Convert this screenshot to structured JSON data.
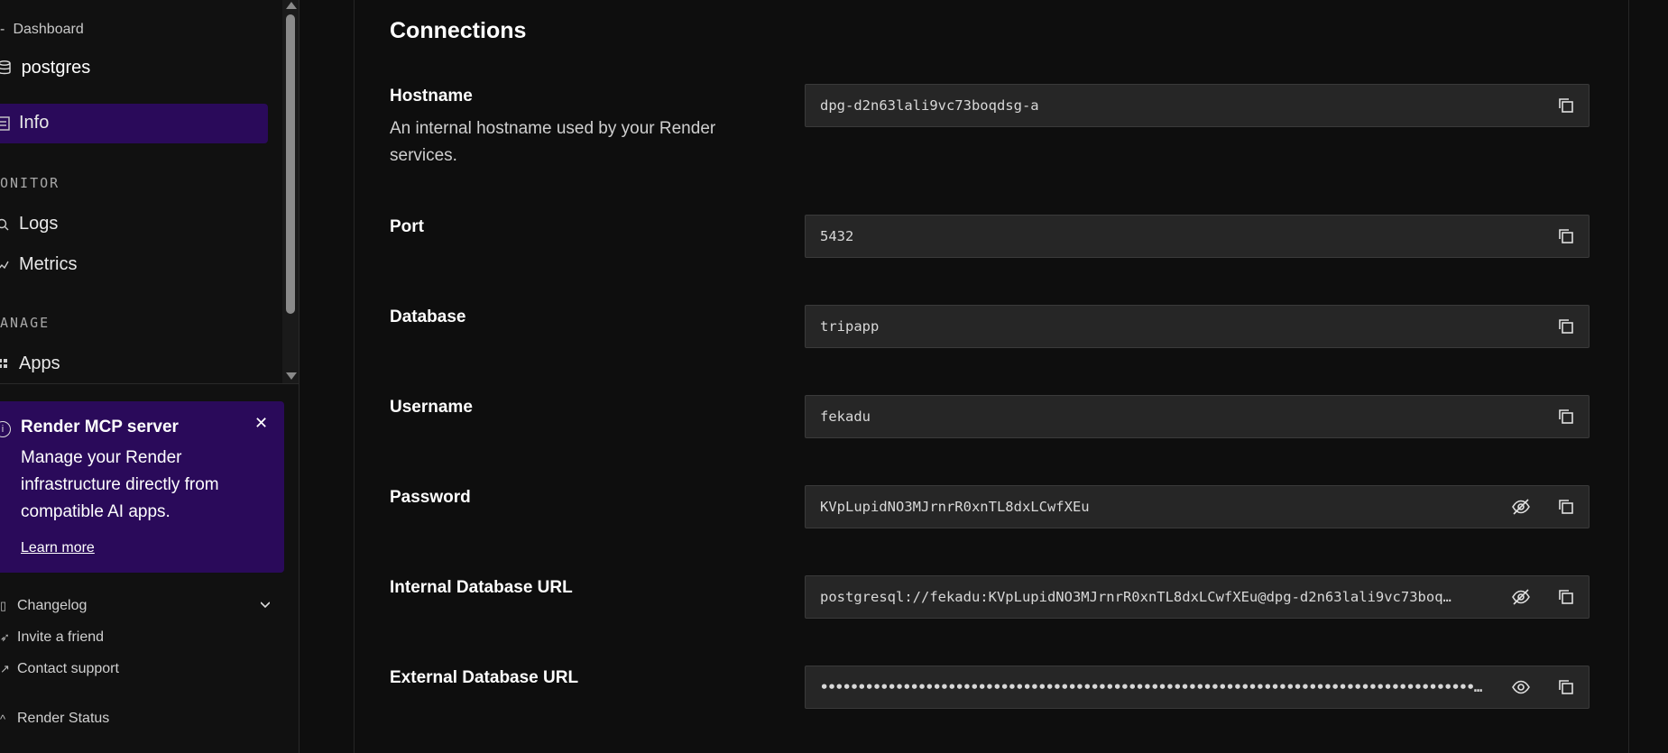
{
  "sidebar": {
    "back_label": "Dashboard",
    "service_name": "postgres",
    "nav": {
      "info": "Info",
      "monitor_section": "ONITOR",
      "logs": "Logs",
      "metrics": "Metrics",
      "manage_section": "ANAGE",
      "apps": "Apps"
    },
    "promo": {
      "title": "Render MCP server",
      "description": "Manage your Render infrastructure directly from compatible AI apps.",
      "link": "Learn more"
    },
    "footer": {
      "changelog": "Changelog",
      "invite": "Invite a friend",
      "support": "Contact support",
      "status": "Render Status"
    }
  },
  "connections": {
    "heading": "Connections",
    "hostname": {
      "label": "Hostname",
      "description": "An internal hostname used by your Render services.",
      "value": "dpg-d2n63lali9vc73boqdsg-a"
    },
    "port": {
      "label": "Port",
      "value": "5432"
    },
    "database": {
      "label": "Database",
      "value": "tripapp"
    },
    "username": {
      "label": "Username",
      "value": "fekadu"
    },
    "password": {
      "label": "Password",
      "value": "KVpLupidNO3MJrnrR0xnTL8dxLCwfXEu"
    },
    "internal_url": {
      "label": "Internal Database URL",
      "value": "postgresql://fekadu:KVpLupidNO3MJrnrR0xnTL8dxLCwfXEu@dpg-d2n63lali9vc73boq…"
    },
    "external_url": {
      "label": "External Database URL",
      "value": "•••••••••••••••••••••••••••••••••••••••••••••••••••••••••••••••••••••••••••••••••••••••••••••••••••…"
    }
  },
  "icons": {
    "copy": "copy-icon",
    "eye_off": "eye-off-icon",
    "eye": "eye-icon"
  },
  "colors": {
    "accent": "#2a0a5a",
    "background": "#0e0e0e",
    "field_bg": "#262626"
  }
}
